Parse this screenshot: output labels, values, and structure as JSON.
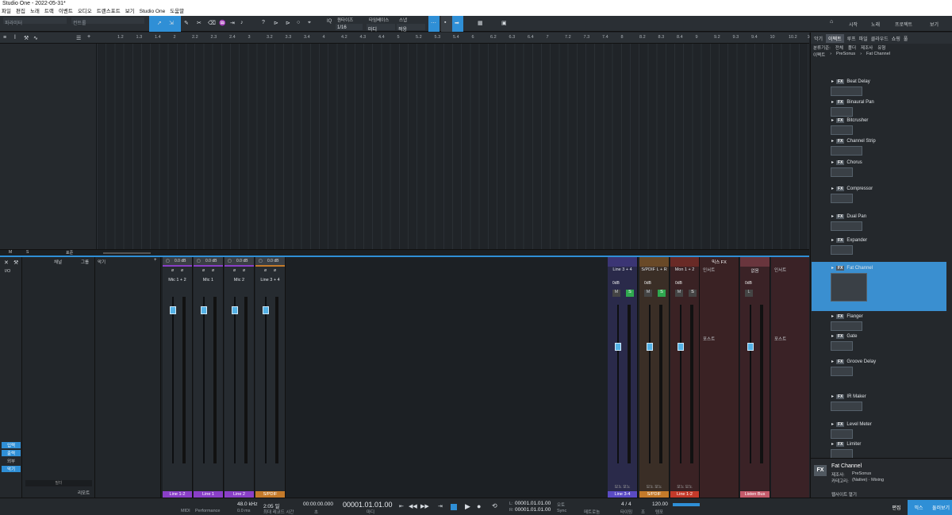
{
  "app": {
    "title": "Studio One - 2022-05-31*"
  },
  "menu": [
    "파일",
    "편집",
    "노래",
    "트랙",
    "이벤트",
    "오디오",
    "트랜스포트",
    "보기",
    "Studio One",
    "도움말"
  ],
  "toolbar": {
    "param_label": "파라미터",
    "control_label": "컨트롤",
    "quantize_label": "IQ",
    "quantize_value": "1/16",
    "snap_label": "퀀타이즈",
    "timebase_label": "타임베이스",
    "timebase_value": "마디",
    "snap_mode_label": "스냅",
    "snap_mode_value": "적응",
    "start_label": "시작",
    "song_label": "노래",
    "project_label": "프로젝트",
    "view_label": "보기"
  },
  "ruler": {
    "ticks": [
      "1.2",
      "1.3",
      "1.4",
      "2",
      "2.2",
      "2.3",
      "2.4",
      "3",
      "3.2",
      "3.3",
      "3.4",
      "4",
      "4.2",
      "4.3",
      "4.4",
      "5",
      "5.2",
      "5.3",
      "5.4",
      "6",
      "6.2",
      "6.3",
      "6.4",
      "7",
      "7.2",
      "7.3",
      "7.4",
      "8",
      "8.2",
      "8.3",
      "8.4",
      "9",
      "9.2",
      "9.3",
      "9.4",
      "10",
      "10.2",
      "10.3",
      "10.4",
      "11"
    ]
  },
  "arrange_footer": {
    "m_label": "M",
    "s_label": "S",
    "std_label": "표준"
  },
  "console": {
    "left_nav": {
      "io": "I/O",
      "input": "입력",
      "output": "출력",
      "external": "외부",
      "instrument": "악기"
    },
    "channel_list": {
      "col_channel": "채널",
      "col_group": "그룹",
      "search_placeholder": "필터",
      "remote": "리모트"
    },
    "instrument_pane": {
      "label": "악기"
    },
    "strips": [
      {
        "name": "Mic 1 + 2",
        "db": "0.0 dB",
        "foot": "Line 1-2",
        "color": "#8a3fc7"
      },
      {
        "name": "Mic 1",
        "db": "0.0 dB",
        "foot": "Line 1",
        "color": "#8a3fc7"
      },
      {
        "name": "Mic 2",
        "db": "0.0 dB",
        "foot": "Line 2",
        "color": "#8a3fc7"
      },
      {
        "name": "Line 3 + 4",
        "db": "0.0 dB",
        "foot": "S/PDIF",
        "color": "#c47a2a"
      }
    ],
    "out_strips": [
      {
        "name": "Line 3 + 4",
        "db": "0dB",
        "foot": "Line 3-4",
        "sub": "모노 모노",
        "color": "#5b4bc4",
        "bg": "#2a2a4a"
      },
      {
        "name": "S/PDIF L + R",
        "db": "0dB",
        "foot": "S/PDIF",
        "sub": "모노 모노",
        "color": "#c47a2a",
        "bg": "#3a2e26"
      },
      {
        "name": "Mon 1 + 2",
        "db": "0dB",
        "foot": "Line 1-2",
        "sub": "모노 모노",
        "color": "#c43a2a",
        "bg": "#3a2224"
      },
      {
        "name": "없음",
        "db": "0dB",
        "foot": "Listen Bus",
        "sub": "",
        "color": "#c45a6a",
        "bg": "#3a2226"
      }
    ],
    "mix_fx": "믹스 FX",
    "insert_label": "인서트",
    "post_label": "포스트",
    "m_btn": "M",
    "s_btn": "S",
    "l_btn": "L"
  },
  "browser": {
    "tabs": [
      "악기",
      "이펙트",
      "루프",
      "파일",
      "클라우드",
      "쇼핑",
      "풀"
    ],
    "active_tab": "이펙트",
    "sort_label": "분류기준:",
    "sort_options": [
      "전체",
      "폴더",
      "제조사",
      "유형"
    ],
    "breadcrumb": [
      "이펙트",
      "PreSonus",
      "Fat Channel"
    ],
    "items": [
      "Beat Delay",
      "Binaural Pan",
      "Bitcrusher",
      "Channel Strip",
      "Chorus",
      "Compressor",
      "Dual Pan",
      "Expander",
      "Fat Channel",
      "Flanger",
      "Gate",
      "Groove Delay",
      "IR Maker",
      "Level Meter",
      "Limiter"
    ],
    "selected": "Fat Channel",
    "info": {
      "name": "Fat Channel",
      "vendor_label": "제조사:",
      "vendor": "PreSonus",
      "category_label": "카테고리:",
      "category": "(Native) · Mixing",
      "open_label": "웹사이트 열기"
    }
  },
  "transport": {
    "midi_label": "MIDI",
    "perf_label": "Performance",
    "sample_rate": "48.0 kHz",
    "latency": "0.0 ms",
    "record_time": "2:05 일",
    "record_label": "최대 레코드 시간",
    "time_primary": "00:00:00.000",
    "time_primary_label": "초",
    "bars": "00001.01.01.00",
    "bars_label": "마디",
    "l_pos": "00001.01.01.00",
    "r_pos": "00001.01.01.00",
    "sync_label": "Sync",
    "auto_label": "오토",
    "metronome_label": "메트로놈",
    "time_sig": "4 / 4",
    "time_sig_label": "타이밍",
    "tempo": "120.00",
    "tempo_label": "템포",
    "key_label": "조",
    "edit_btn": "편집",
    "mix_btn": "믹스",
    "browse_btn": "둘러보기"
  }
}
